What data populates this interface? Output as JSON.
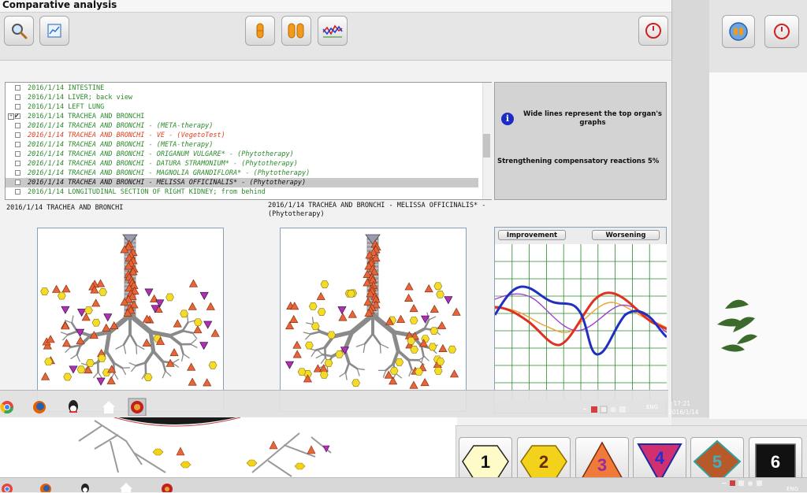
{
  "window": {
    "title": "Comparative analysis"
  },
  "toolbar": {
    "icons": [
      "magnifier-icon",
      "calendar-chart-icon",
      "single-capsule-icon",
      "double-capsule-icon",
      "graph-lines-icon",
      "power-icon"
    ]
  },
  "list": {
    "rows": [
      {
        "text": "2016/1/14  INTESTINE",
        "color": "#2b8a2b",
        "italic": false,
        "checked": false,
        "selected": false,
        "expander": false
      },
      {
        "text": "2016/1/14  LIVER; back view",
        "color": "#2b8a2b",
        "italic": false,
        "checked": false,
        "selected": false,
        "expander": false
      },
      {
        "text": "2016/1/14  LEFT  LUNG",
        "color": "#2b8a2b",
        "italic": false,
        "checked": false,
        "selected": false,
        "expander": false
      },
      {
        "text": "2016/1/14  TRACHEA  AND  BRONCHI",
        "color": "#2b8a2b",
        "italic": false,
        "checked": true,
        "selected": false,
        "expander": true
      },
      {
        "text": "2016/1/14  TRACHEA  AND  BRONCHI - (META-therapy)",
        "color": "#2b8a2b",
        "italic": true,
        "checked": false,
        "selected": false,
        "expander": false
      },
      {
        "text": "2016/1/14  TRACHEA  AND  BRONCHI - VE - (VegetoTest)",
        "color": "#e0401e",
        "italic": true,
        "checked": false,
        "selected": false,
        "expander": false
      },
      {
        "text": "2016/1/14  TRACHEA  AND  BRONCHI - (META-therapy)",
        "color": "#2b8a2b",
        "italic": true,
        "checked": false,
        "selected": false,
        "expander": false
      },
      {
        "text": "2016/1/14  TRACHEA  AND  BRONCHI - ORIGANUM  VULGARE* - (Phytotherapy)",
        "color": "#2b8a2b",
        "italic": true,
        "checked": false,
        "selected": false,
        "expander": false
      },
      {
        "text": "2016/1/14  TRACHEA  AND  BRONCHI - DATURA  STRAMONIUM* - (Phytotherapy)",
        "color": "#2b8a2b",
        "italic": true,
        "checked": false,
        "selected": false,
        "expander": false
      },
      {
        "text": "2016/1/14  TRACHEA  AND  BRONCHI - MAGNOLIA  GRANDIFLORA* - (Phytotherapy)",
        "color": "#2b8a2b",
        "italic": true,
        "checked": false,
        "selected": false,
        "expander": false
      },
      {
        "text": "2016/1/14  TRACHEA  AND  BRONCHI - MELISSA  OFFICINALIS* - (Phytotherapy)",
        "color": "#111111",
        "italic": true,
        "checked": false,
        "selected": true,
        "expander": false
      },
      {
        "text": "2016/1/14  LONGITUDINAL  SECTION  OF  RIGHT  KIDNEY; from behind",
        "color": "#2b8a2b",
        "italic": false,
        "checked": false,
        "selected": false,
        "expander": false
      }
    ]
  },
  "info": {
    "icon": "info-icon",
    "icon_glyph": "i",
    "text1": "Wide lines represent the top organ's graphs",
    "text2": "Strengthening compensatory reactions 5%"
  },
  "labels": {
    "left": "2016/1/14  TRACHEA  AND  BRONCHI",
    "right": "2016/1/14  TRACHEA  AND  BRONCHI - MELISSA  OFFICINALIS* - (Phytotherapy)"
  },
  "graph": {
    "improvement_label": "Improvement",
    "worsening_label": "Worsening",
    "colors": {
      "blue": "#1f2fc0",
      "red": "#e0301e",
      "orange": "#f0a030",
      "purple": "#a040d0",
      "grid": "#2a8a2a"
    }
  },
  "taskbar_inner": {
    "time": "17:21",
    "date": "2016/1/14",
    "lang": "ENG"
  },
  "taskbar_outer": {
    "lang": "ENG"
  },
  "bottom_buttons": [
    {
      "label": "1",
      "shape": "hexagon",
      "color": "#fffbc8"
    },
    {
      "label": "2",
      "shape": "hexagon",
      "color": "#f2d21a"
    },
    {
      "label": "3",
      "shape": "triangle-up",
      "color": "#f07a3a"
    },
    {
      "label": "4",
      "shape": "triangle-down",
      "color": "#d03070"
    },
    {
      "label": "5",
      "shape": "diamond",
      "color": "#b8592a"
    },
    {
      "label": "6",
      "shape": "square",
      "color": "#111111"
    }
  ]
}
